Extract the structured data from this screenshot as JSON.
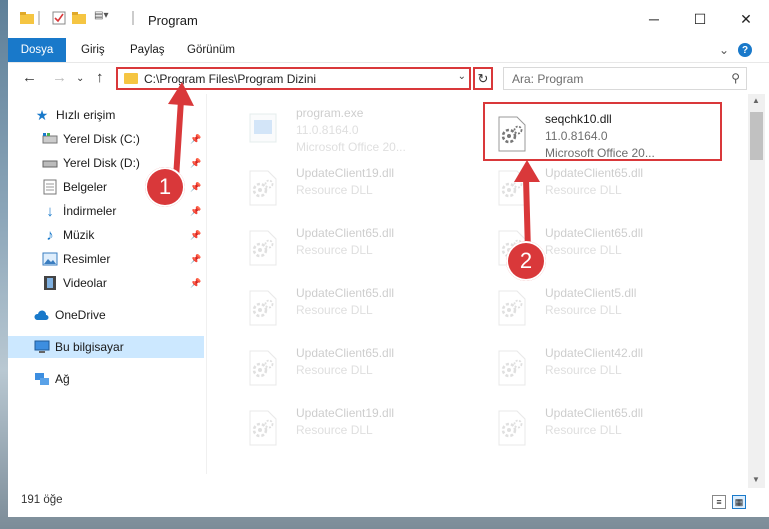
{
  "window": {
    "title": "Program",
    "minimize": "─",
    "maximize": "☐",
    "close": "✕"
  },
  "ribbon": {
    "tabs": [
      "Dosya",
      "Giriş",
      "Paylaş",
      "Görünüm"
    ]
  },
  "address": {
    "path": "C:\\Program Files\\Program Dizini",
    "search_placeholder": "Ara: Program"
  },
  "sidebar": {
    "items": [
      {
        "label": "Hızlı erişim",
        "icon": "star-icon"
      },
      {
        "label": "Yerel Disk (C:)",
        "icon": "drive-icon"
      },
      {
        "label": "Yerel Disk (D:)",
        "icon": "drive-icon"
      },
      {
        "label": "Belgeler",
        "icon": "documents-icon"
      },
      {
        "label": "İndirmeler",
        "icon": "download-icon"
      },
      {
        "label": "Müzik",
        "icon": "music-icon"
      },
      {
        "label": "Resimler",
        "icon": "pictures-icon"
      },
      {
        "label": "Videolar",
        "icon": "video-icon"
      },
      {
        "label": "OneDrive",
        "icon": "cloud-icon"
      },
      {
        "label": "Bu bilgisayar",
        "icon": "computer-icon"
      },
      {
        "label": "Ağ",
        "icon": "network-icon"
      }
    ]
  },
  "files": [
    {
      "name": "program.exe",
      "d1": "11.0.8164.0",
      "d2": "Microsoft Office 20...",
      "icon": "exe-icon"
    },
    {
      "name": "seqchk10.dll",
      "d1": "11.0.8164.0",
      "d2": "Microsoft Office 20...",
      "icon": "dll-gear-icon"
    },
    {
      "name": "UpdateClient19.dll",
      "d1": "Resource DLL",
      "d2": "",
      "icon": "dll-gear-icon"
    },
    {
      "name": "UpdateClient65.dll",
      "d1": "Resource DLL",
      "d2": "",
      "icon": "dll-gear-icon"
    },
    {
      "name": "UpdateClient65.dll",
      "d1": "Resource DLL",
      "d2": "",
      "icon": "dll-gear-icon"
    },
    {
      "name": "UpdateClient65.dll",
      "d1": "Resource DLL",
      "d2": "",
      "icon": "dll-gear-icon"
    },
    {
      "name": "UpdateClient65.dll",
      "d1": "Resource DLL",
      "d2": "",
      "icon": "dll-gear-icon"
    },
    {
      "name": "UpdateClient5.dll",
      "d1": "Resource DLL",
      "d2": "",
      "icon": "dll-gear-icon"
    },
    {
      "name": "UpdateClient65.dll",
      "d1": "Resource DLL",
      "d2": "",
      "icon": "dll-gear-icon"
    },
    {
      "name": "UpdateClient42.dll",
      "d1": "Resource DLL",
      "d2": "",
      "icon": "dll-gear-icon"
    },
    {
      "name": "UpdateClient19.dll",
      "d1": "Resource DLL",
      "d2": "",
      "icon": "dll-gear-icon"
    },
    {
      "name": "UpdateClient65.dll",
      "d1": "Resource DLL",
      "d2": "",
      "icon": "dll-gear-icon"
    }
  ],
  "status": {
    "count": "191 öğe"
  },
  "annotations": [
    "1",
    "2"
  ],
  "colors": {
    "accent": "#1979ca",
    "highlight": "#d9383a",
    "selection": "#cce8ff"
  }
}
